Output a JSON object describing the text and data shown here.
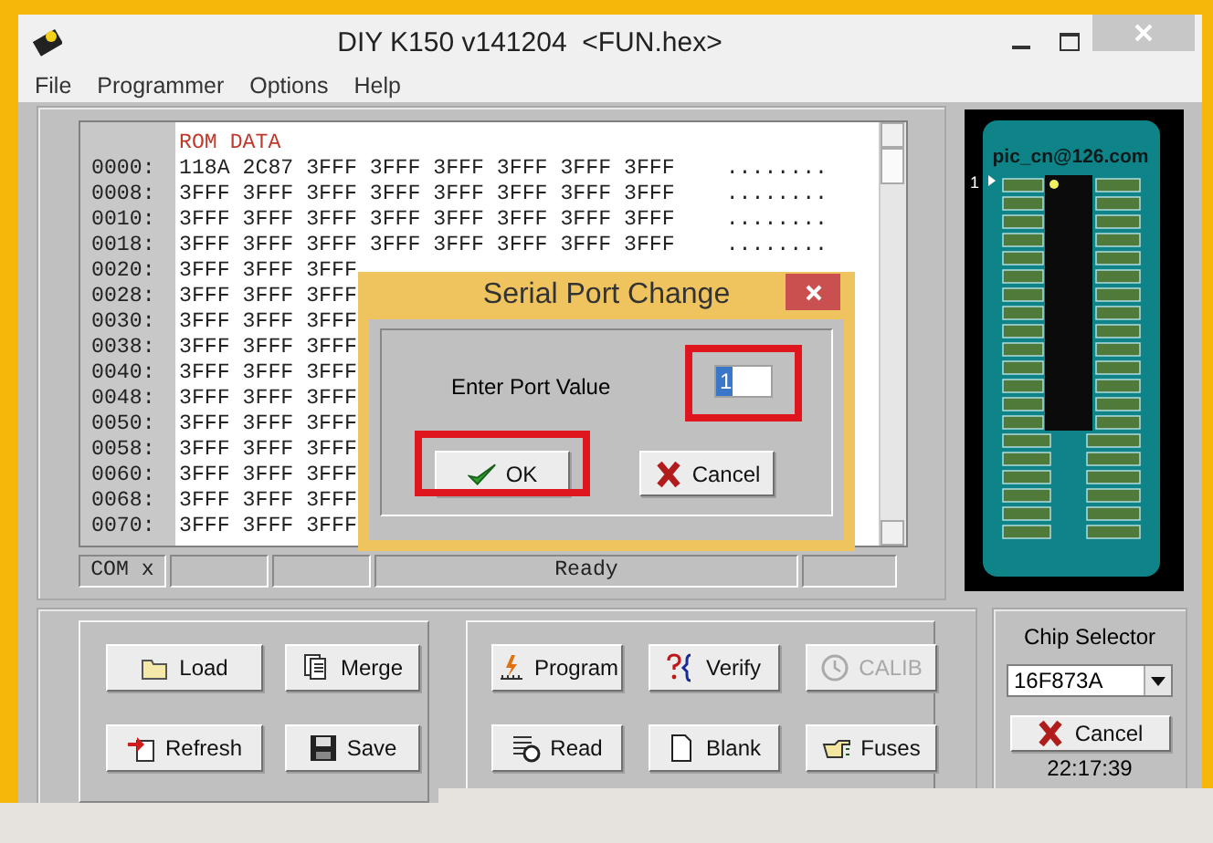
{
  "window": {
    "title": "DIY K150 v141204  <FUN.hex>"
  },
  "menu": [
    "File",
    "Programmer",
    "Options",
    "Help"
  ],
  "hex_view": {
    "header": "ROM DATA",
    "rows": [
      {
        "address": "0000:",
        "words": [
          "118A",
          "2C87",
          "3FFF",
          "3FFF",
          "3FFF",
          "3FFF",
          "3FFF",
          "3FFF"
        ],
        "ascii": "........"
      },
      {
        "address": "0008:",
        "words": [
          "3FFF",
          "3FFF",
          "3FFF",
          "3FFF",
          "3FFF",
          "3FFF",
          "3FFF",
          "3FFF"
        ],
        "ascii": "........"
      },
      {
        "address": "0010:",
        "words": [
          "3FFF",
          "3FFF",
          "3FFF",
          "3FFF",
          "3FFF",
          "3FFF",
          "3FFF",
          "3FFF"
        ],
        "ascii": "........"
      },
      {
        "address": "0018:",
        "words": [
          "3FFF",
          "3FFF",
          "3FFF",
          "3FFF",
          "3FFF",
          "3FFF",
          "3FFF",
          "3FFF"
        ],
        "ascii": "........"
      },
      {
        "address": "0020:",
        "words": [
          "3FFF",
          "3FFF",
          "3FFF"
        ]
      },
      {
        "address": "0028:",
        "words": [
          "3FFF",
          "3FFF",
          "3FFF"
        ]
      },
      {
        "address": "0030:",
        "words": [
          "3FFF",
          "3FFF",
          "3FFF"
        ]
      },
      {
        "address": "0038:",
        "words": [
          "3FFF",
          "3FFF",
          "3FFF"
        ]
      },
      {
        "address": "0040:",
        "words": [
          "3FFF",
          "3FFF",
          "3FFF"
        ]
      },
      {
        "address": "0048:",
        "words": [
          "3FFF",
          "3FFF",
          "3FFF"
        ]
      },
      {
        "address": "0050:",
        "words": [
          "3FFF",
          "3FFF",
          "3FFF"
        ]
      },
      {
        "address": "0058:",
        "words": [
          "3FFF",
          "3FFF",
          "3FFF"
        ]
      },
      {
        "address": "0060:",
        "words": [
          "3FFF",
          "3FFF",
          "3FFF"
        ]
      },
      {
        "address": "0068:",
        "words": [
          "3FFF",
          "3FFF",
          "3FFF"
        ]
      },
      {
        "address": "0070:",
        "words": [
          "3FFF",
          "3FFF",
          "3FFF"
        ]
      }
    ]
  },
  "status_bar": {
    "port": "COM x",
    "message": "Ready"
  },
  "chip_view": {
    "label": "pic_cn@126.com",
    "pin_marker": "1"
  },
  "button_groups": [
    {
      "buttons": [
        {
          "label": "Load",
          "disabled": false
        },
        {
          "label": "Merge",
          "disabled": false
        },
        {
          "label": "Refresh",
          "disabled": false
        },
        {
          "label": "Save",
          "disabled": false
        }
      ]
    },
    {
      "buttons": [
        {
          "label": "Program",
          "disabled": false
        },
        {
          "label": "Verify",
          "disabled": false
        },
        {
          "label": "CALIB",
          "disabled": true
        },
        {
          "label": "Read",
          "disabled": false
        },
        {
          "label": "Blank",
          "disabled": false
        },
        {
          "label": "Fuses",
          "disabled": false
        }
      ]
    }
  ],
  "chip_selector": {
    "title": "Chip Selector",
    "value": "16F873A",
    "cancel": "Cancel",
    "time": "22:17:39"
  },
  "dialog": {
    "title": "Serial Port Change",
    "field_label": "Enter Port Value",
    "value": "1",
    "field_highlighted": true,
    "buttons": [
      {
        "kind": "ok",
        "label": "OK",
        "highlighted": true
      },
      {
        "kind": "cancel",
        "label": "Cancel",
        "highlighted": false
      }
    ]
  }
}
